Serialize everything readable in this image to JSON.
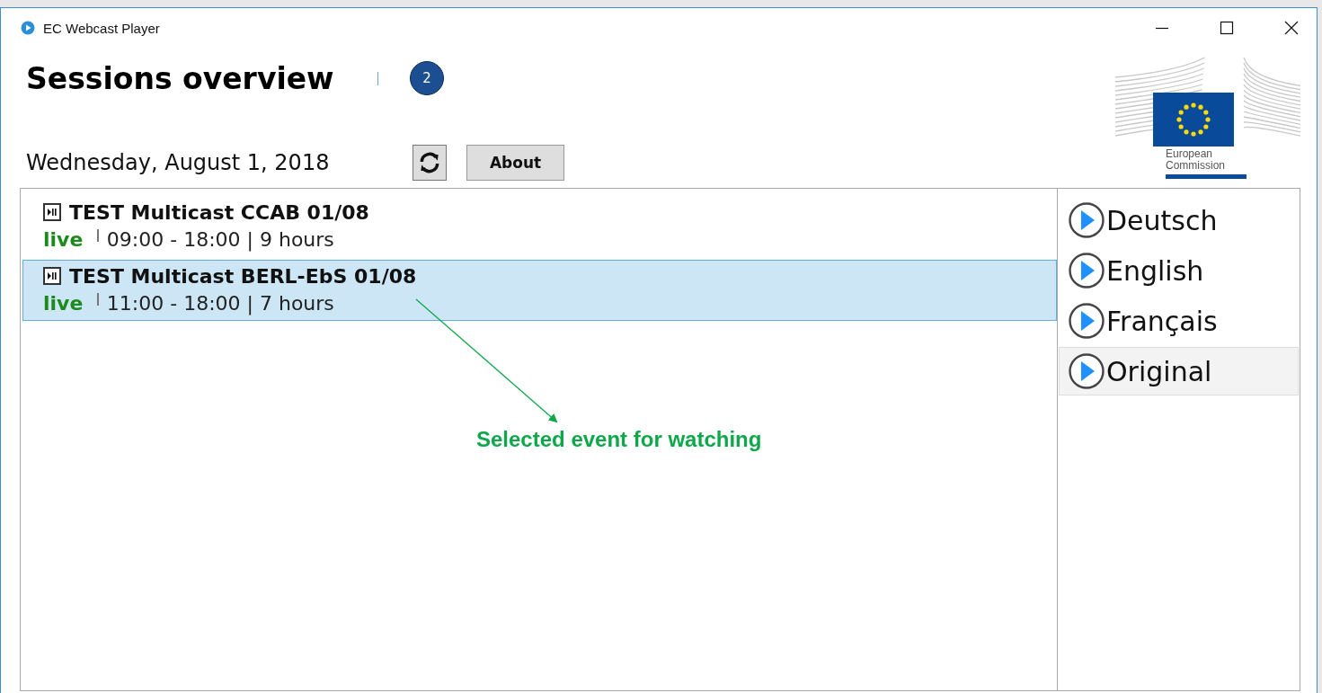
{
  "window": {
    "title": "EC Webcast Player"
  },
  "header": {
    "title": "Sessions overview",
    "badge": "2"
  },
  "date": "Wednesday, August 1, 2018",
  "about_button": "About",
  "logo_text": [
    "European",
    "Commission"
  ],
  "sessions": [
    {
      "title": "TEST Multicast CCAB 01/08",
      "status": "live",
      "time": "09:00 - 18:00 | 9 hours",
      "selected": false
    },
    {
      "title": "TEST Multicast BERL-EbS 01/08",
      "status": "live",
      "time": "11:00 - 18:00 | 7 hours",
      "selected": true
    }
  ],
  "languages": [
    {
      "label": "Deutsch",
      "selected": false
    },
    {
      "label": "English",
      "selected": false
    },
    {
      "label": "Français",
      "selected": false
    },
    {
      "label": "Original",
      "selected": true
    }
  ],
  "annotation": {
    "text": "Selected event for watching"
  }
}
